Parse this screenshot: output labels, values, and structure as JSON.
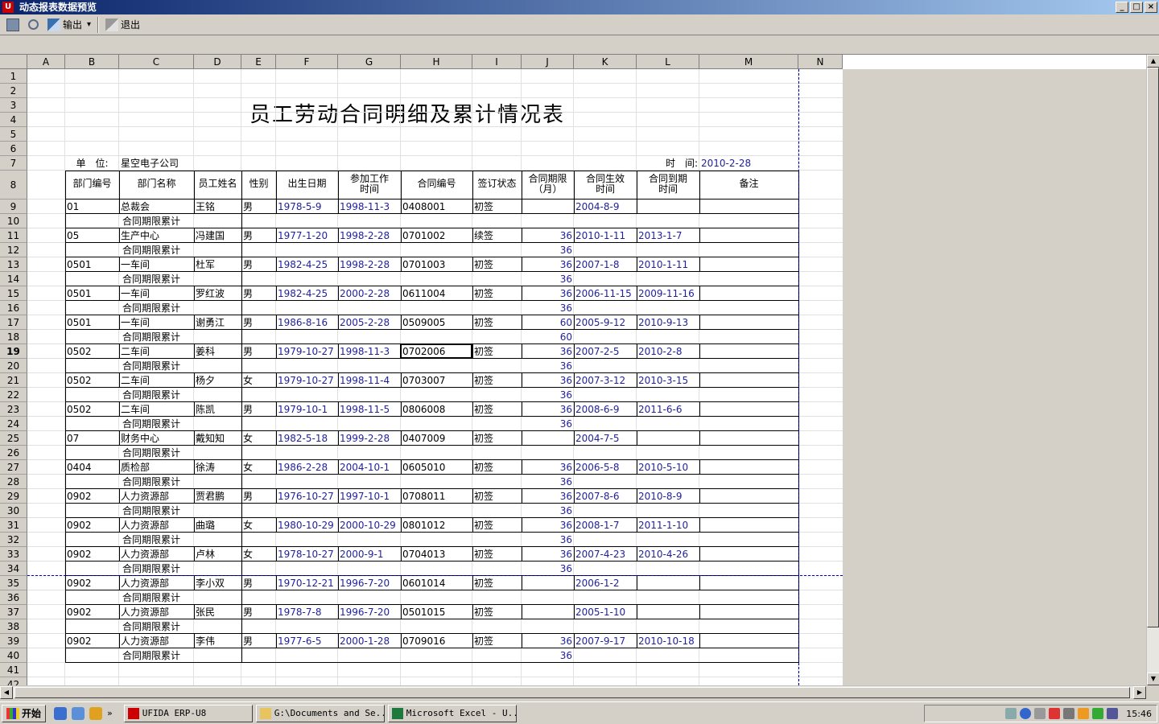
{
  "window": {
    "title": "动态报表数据预览",
    "min": "_",
    "max": "□",
    "close": "×"
  },
  "toolbar": {
    "export_label": "输出",
    "dropdown": "▾",
    "exit_label": "退出"
  },
  "columns": [
    "A",
    "B",
    "C",
    "D",
    "E",
    "F",
    "G",
    "H",
    "I",
    "J",
    "K",
    "L",
    "M",
    "N"
  ],
  "report": {
    "title": "员工劳动合同明细及累计情况表",
    "unit_label": "单　位:",
    "unit_value": "星空电子公司",
    "time_label": "时　间:",
    "time_value": "2010-2-28",
    "headers": [
      "部门编号",
      "部门名称",
      "员工姓名",
      "性别",
      "出生日期",
      "参加工作\n时间",
      "合同编号",
      "签订状态",
      "合同期限\n（月）",
      "合同生效\n时间",
      "合同到期\n时间",
      "备注"
    ],
    "subtotal_label": "合同期限累计",
    "employees": [
      {
        "dept": "01",
        "dept_name": "总裁会",
        "name": "王铭",
        "sex": "男",
        "birth": "1978-5-9",
        "work": "1998-11-3",
        "contract": "0408001",
        "status": "初签",
        "term": "",
        "start": "2004-8-9",
        "end": "",
        "total": ""
      },
      {
        "dept": "05",
        "dept_name": "生产中心",
        "name": "冯建国",
        "sex": "男",
        "birth": "1977-1-20",
        "work": "1998-2-28",
        "contract": "0701002",
        "status": "续签",
        "term": "36",
        "start": "2010-1-11",
        "end": "2013-1-7",
        "total": "36"
      },
      {
        "dept": "0501",
        "dept_name": "一车间",
        "name": "杜军",
        "sex": "男",
        "birth": "1982-4-25",
        "work": "1998-2-28",
        "contract": "0701003",
        "status": "初签",
        "term": "36",
        "start": "2007-1-8",
        "end": "2010-1-11",
        "total": "36"
      },
      {
        "dept": "0501",
        "dept_name": "一车间",
        "name": "罗红波",
        "sex": "男",
        "birth": "1982-4-25",
        "work": "2000-2-28",
        "contract": "0611004",
        "status": "初签",
        "term": "36",
        "start": "2006-11-15",
        "end": "2009-11-16",
        "total": "36"
      },
      {
        "dept": "0501",
        "dept_name": "一车间",
        "name": "谢勇江",
        "sex": "男",
        "birth": "1986-8-16",
        "work": "2005-2-28",
        "contract": "0509005",
        "status": "初签",
        "term": "60",
        "start": "2005-9-12",
        "end": "2010-9-13",
        "total": "60"
      },
      {
        "dept": "0502",
        "dept_name": "二车间",
        "name": "姜科",
        "sex": "男",
        "birth": "1979-10-27",
        "work": "1998-11-3",
        "contract": "0702006",
        "status": "初签",
        "term": "36",
        "start": "2007-2-5",
        "end": "2010-2-8",
        "total": "36"
      },
      {
        "dept": "0502",
        "dept_name": "二车间",
        "name": "杨夕",
        "sex": "女",
        "birth": "1979-10-27",
        "work": "1998-11-4",
        "contract": "0703007",
        "status": "初签",
        "term": "36",
        "start": "2007-3-12",
        "end": "2010-3-15",
        "total": "36"
      },
      {
        "dept": "0502",
        "dept_name": "二车间",
        "name": "陈凯",
        "sex": "男",
        "birth": "1979-10-1",
        "work": "1998-11-5",
        "contract": "0806008",
        "status": "初签",
        "term": "36",
        "start": "2008-6-9",
        "end": "2011-6-6",
        "total": "36"
      },
      {
        "dept": "07",
        "dept_name": "财务中心",
        "name": "戴知知",
        "sex": "女",
        "birth": "1982-5-18",
        "work": "1999-2-28",
        "contract": "0407009",
        "status": "初签",
        "term": "",
        "start": "2004-7-5",
        "end": "",
        "total": ""
      },
      {
        "dept": "0404",
        "dept_name": "质检部",
        "name": "徐涛",
        "sex": "女",
        "birth": "1986-2-28",
        "work": "2004-10-1",
        "contract": "0605010",
        "status": "初签",
        "term": "36",
        "start": "2006-5-8",
        "end": "2010-5-10",
        "total": "36"
      },
      {
        "dept": "0902",
        "dept_name": "人力资源部",
        "name": "贾君鹏",
        "sex": "男",
        "birth": "1976-10-27",
        "work": "1997-10-1",
        "contract": "0708011",
        "status": "初签",
        "term": "36",
        "start": "2007-8-6",
        "end": "2010-8-9",
        "total": "36"
      },
      {
        "dept": "0902",
        "dept_name": "人力资源部",
        "name": "曲璐",
        "sex": "女",
        "birth": "1980-10-29",
        "work": "2000-10-29",
        "contract": "0801012",
        "status": "初签",
        "term": "36",
        "start": "2008-1-7",
        "end": "2011-1-10",
        "total": "36"
      },
      {
        "dept": "0902",
        "dept_name": "人力资源部",
        "name": "卢林",
        "sex": "女",
        "birth": "1978-10-27",
        "work": "2000-9-1",
        "contract": "0704013",
        "status": "初签",
        "term": "36",
        "start": "2007-4-23",
        "end": "2010-4-26",
        "total": "36"
      },
      {
        "dept": "0902",
        "dept_name": "人力资源部",
        "name": "李小双",
        "sex": "男",
        "birth": "1970-12-21",
        "work": "1996-7-20",
        "contract": "0601014",
        "status": "初签",
        "term": "",
        "start": "2006-1-2",
        "end": "",
        "total": ""
      },
      {
        "dept": "0902",
        "dept_name": "人力资源部",
        "name": "张民",
        "sex": "男",
        "birth": "1978-7-8",
        "work": "1996-7-20",
        "contract": "0501015",
        "status": "初签",
        "term": "",
        "start": "2005-1-10",
        "end": "",
        "total": ""
      },
      {
        "dept": "0902",
        "dept_name": "人力资源部",
        "name": "李伟",
        "sex": "男",
        "birth": "1977-6-5",
        "work": "2000-1-28",
        "contract": "0709016",
        "status": "初签",
        "term": "36",
        "start": "2007-9-17",
        "end": "2010-10-18",
        "total": "36"
      }
    ]
  },
  "taskbar": {
    "start_label": "开始",
    "more": "»",
    "tasks": [
      "UFIDA ERP-U8",
      "G:\\Documents and Se...",
      "Microsoft Excel - U..."
    ],
    "clock": "15:46"
  },
  "colors": {
    "data_blue": "#1f1f9f",
    "title_bar": "#0a246a",
    "page_break": "#0000c0"
  }
}
